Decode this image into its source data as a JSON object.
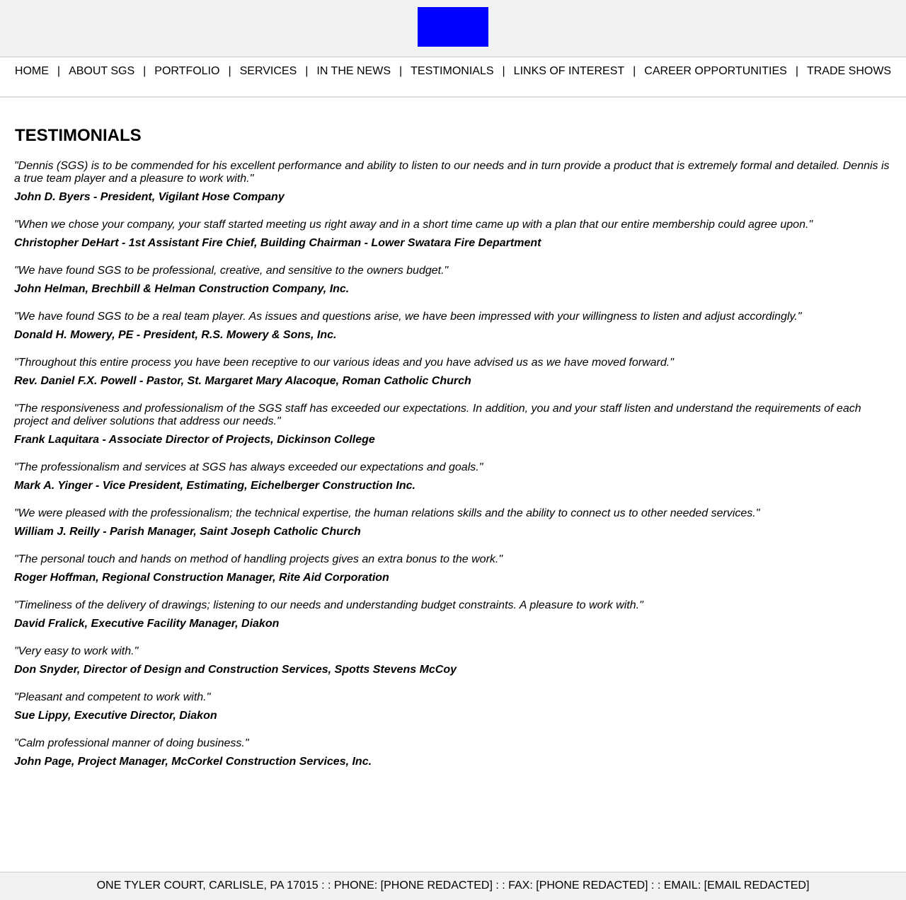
{
  "header": {
    "logo_color": "#0000ff"
  },
  "nav": {
    "separator": "|",
    "items": [
      {
        "label": "HOME"
      },
      {
        "label": "ABOUT SGS"
      },
      {
        "label": "PORTFOLIO"
      },
      {
        "label": "SERVICES"
      },
      {
        "label": "IN THE NEWS"
      },
      {
        "label": "TESTIMONIALS"
      },
      {
        "label": "LINKS OF INTEREST"
      },
      {
        "label": "CAREER OPPORTUNITIES"
      },
      {
        "label": "TRADE SHOWS"
      }
    ]
  },
  "main": {
    "title": "TESTIMONIALS",
    "testimonials": [
      {
        "quote": "\"Dennis (SGS) is to be commended for his excellent performance and ability to listen to our needs and in turn provide a product that is extremely formal and detailed. Dennis is a true team player and a pleasure to work with.\"",
        "author": "John D. Byers - President, Vigilant Hose Company"
      },
      {
        "quote": "\"When we chose your company, your staff started meeting us right away and in a short time came up with a plan that our entire membership could agree upon.\"",
        "author": "Christopher DeHart - 1st Assistant Fire Chief, Building Chairman - Lower Swatara Fire Department"
      },
      {
        "quote": "\"We have found SGS to be professional, creative, and sensitive to the owners budget.\"",
        "author": "John Helman, Brechbill & Helman Construction Company, Inc."
      },
      {
        "quote": "\"We have found SGS to be a real team player. As issues and questions arise, we have been impressed with your willingness to listen and adjust accordingly.\"",
        "author": "Donald H. Mowery, PE - President, R.S. Mowery & Sons, Inc."
      },
      {
        "quote": "\"Throughout this entire process you have been receptive to our various ideas and you have advised us as we have moved forward.\"",
        "author": "Rev. Daniel F.X. Powell - Pastor, St. Margaret Mary Alacoque, Roman Catholic Church"
      },
      {
        "quote": "\"The responsiveness and professionalism of the SGS staff has exceeded our expectations. In addition, you and your staff listen and understand the requirements of each project and deliver solutions that address our needs.\"",
        "author": "Frank Laquitara - Associate Director of Projects, Dickinson College"
      },
      {
        "quote": "\"The professionalism and services at SGS has always exceeded our expectations and goals.\"",
        "author": "Mark A. Yinger - Vice President, Estimating, Eichelberger Construction Inc."
      },
      {
        "quote": "\"We were pleased with the professionalism; the technical expertise, the human relations skills and the ability to connect us to other needed services.\"",
        "author": "William J. Reilly - Parish Manager, Saint Joseph Catholic Church"
      },
      {
        "quote": "\"The personal touch and hands on method of handling projects gives an extra bonus to the work.\"",
        "author": "Roger Hoffman, Regional Construction Manager, Rite Aid Corporation"
      },
      {
        "quote": "\"Timeliness of the delivery of drawings; listening to our needs and understanding budget constraints. A pleasure to work with.\"",
        "author": "David Fralick, Executive Facility Manager, Diakon"
      },
      {
        "quote": "\"Very easy to work with.\"",
        "author": "Don Snyder, Director of Design and Construction Services, Spotts Stevens McCoy"
      },
      {
        "quote": "\"Pleasant and competent to work with.\"",
        "author": "Sue Lippy, Executive Director, Diakon"
      },
      {
        "quote": "\"Calm professional manner of doing business.\"",
        "author": "John Page, Project Manager, McCorkel Construction Services, Inc."
      }
    ]
  },
  "footer": {
    "text": "ONE TYLER COURT, CARLISLE, PA 17015 : : PHONE: [PHONE REDACTED] : : FAX: [PHONE REDACTED] : : EMAIL: [EMAIL REDACTED]"
  }
}
